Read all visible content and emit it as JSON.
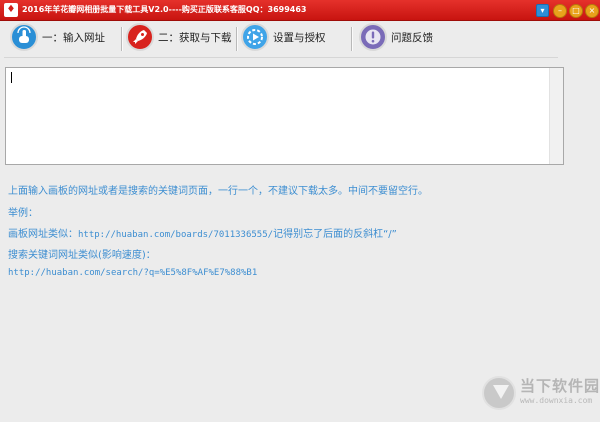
{
  "window": {
    "title": "2016年羊花瓣网相册批量下载工具V2.0----购买正版联系客服QQ：3699463",
    "icon_name": "app-logo-icon",
    "title_color": "#d01a16"
  },
  "window_controls": {
    "skin_icon": "skin-icon",
    "minimize_icon": "minimize-icon",
    "maximize_icon": "maximize-icon",
    "close_icon": "close-icon"
  },
  "toolbar": {
    "items": [
      {
        "label": "一：输入网址",
        "icon": "touch-hand-icon",
        "color": "#2a8fd6"
      },
      {
        "label": "二：获取与下载",
        "icon": "rocket-icon",
        "color": "#d8231e"
      },
      {
        "label": "设置与授权",
        "icon": "settings-play-icon",
        "color": "#3fa4e8"
      },
      {
        "label": "问题反馈",
        "icon": "exclamation-icon",
        "color": "#7a6bb8"
      }
    ]
  },
  "url_input": {
    "value": "",
    "placeholder": ""
  },
  "help": {
    "line1": "上面输入画板的网址或者是搜索的关键词页面，一行一个，不建议下载太多。中间不要留空行。",
    "line2": "举例：",
    "line3_prefix": "画板网址类似：",
    "line3_url": "http://huaban.com/boards/7011336555/",
    "line3_suffix": "记得别忘了后面的反斜杠“/”",
    "line4": "搜索关键词网址类似(影响速度)：",
    "line5": "http://huaban.com/search/?q=%E5%8F%AF%E7%88%B1",
    "text_color": "#3d8ed1"
  },
  "watermark": {
    "name": "当下软件园",
    "url": "www.downxia.com",
    "icon": "downxia-logo-icon"
  }
}
